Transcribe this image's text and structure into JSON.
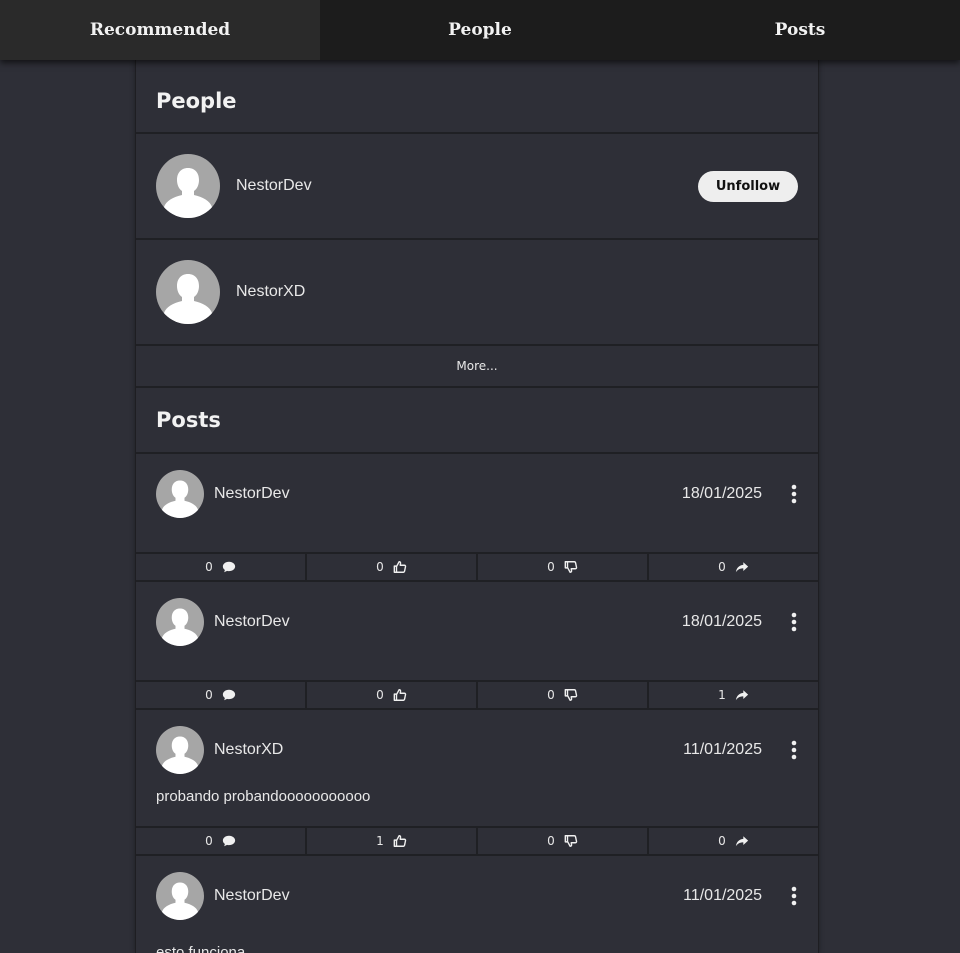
{
  "nav": {
    "tabs": [
      {
        "label": "Recommended",
        "active": true
      },
      {
        "label": "People",
        "active": false
      },
      {
        "label": "Posts",
        "active": false
      }
    ]
  },
  "people": {
    "title": "People",
    "items": [
      {
        "name": "NestorDev",
        "action_label": "Unfollow"
      },
      {
        "name": "NestorXD"
      }
    ],
    "more_label": "More..."
  },
  "posts": {
    "title": "Posts",
    "items": [
      {
        "author": "NestorDev",
        "date": "18/01/2025",
        "text": "",
        "comments": "0",
        "likes": "0",
        "dislikes": "0",
        "shares": "0"
      },
      {
        "author": "NestorDev",
        "date": "18/01/2025",
        "text": "",
        "comments": "0",
        "likes": "0",
        "dislikes": "0",
        "shares": "1"
      },
      {
        "author": "NestorXD",
        "date": "11/01/2025",
        "text": "probando probandooooooooooo",
        "comments": "0",
        "likes": "1",
        "dislikes": "0",
        "shares": "0"
      },
      {
        "author": "NestorDev",
        "date": "11/01/2025",
        "text": "esto funciona"
      }
    ]
  },
  "colors": {
    "background": "#2e2f37",
    "nav": "#1c1c1c",
    "avatar": "#a6a6a6",
    "button": "#eeeeee"
  },
  "icons": {
    "avatar": "user-silhouette-icon",
    "comment": "comment-icon",
    "like": "thumbs-up-icon",
    "dislike": "thumbs-down-icon",
    "share": "share-icon",
    "menu": "kebab-menu-icon"
  }
}
